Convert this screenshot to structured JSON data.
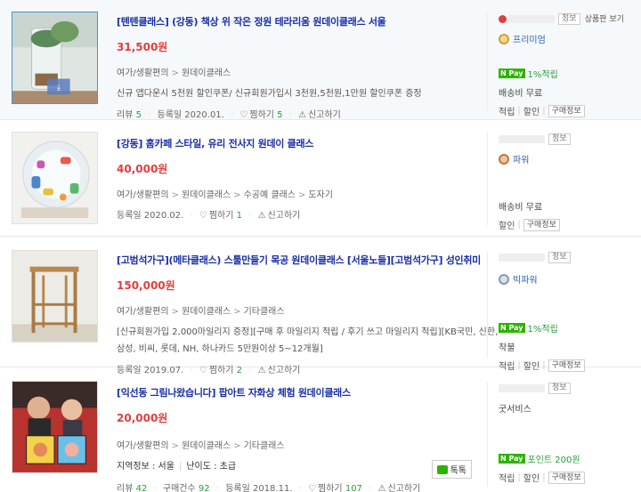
{
  "items": [
    {
      "title": "[텐텐클래스] (강동) 책상 위 작은 정원 테라리움 원데이클래스 서울",
      "price": "31,500원",
      "category": [
        "여가/생활편의",
        "원데이클래스"
      ],
      "desc": "신규 앱다운시 5천원 할인쿠폰/ 신규회원가입시 3천원,5천원,1만원 할인쿠폰 증정",
      "review_label": "리뷰",
      "review_count": "5",
      "reg_date": "등록일 2020.01.",
      "wish_label": "찜하기",
      "wish_count": "5",
      "report_label": "신고하기",
      "seller_info": "정보",
      "more_link": "상품판 보기",
      "grade": "프리미엄",
      "npay": "1%적립",
      "shipping": "배송비 무료",
      "btns": [
        "적립",
        "할인"
      ],
      "mini_btn": "구매정보"
    },
    {
      "title": "[강동] 홈카페 스타일, 유리 전사지 원데이 클래스",
      "price": "40,000원",
      "category": [
        "여가/생활편의",
        "원데이클래스",
        "수공예 클래스",
        "도자기"
      ],
      "reg_date": "등록일 2020.02.",
      "wish_label": "찜하기",
      "wish_count": "1",
      "report_label": "신고하기",
      "seller_info": "정보",
      "grade": "파워",
      "shipping": "배송비 무료",
      "btns": [
        "할인"
      ],
      "mini_btn": "구매정보"
    },
    {
      "title": "[고범석가구](메타클래스) 스툴만들기 목공 원데이클래스 [서울노들][고범석가구] 성인취미",
      "price": "150,000원",
      "category": [
        "여가/생활편의",
        "원데이클래스",
        "기타클래스"
      ],
      "desc1": "[신규회원가입 2,000마일리지 증정][구매 후 마일리지 적립 / 후기 쓰고 마일리지 적립][KB국민, 신한,",
      "desc2": "삼성, 비씨, 롯데, NH, 하나카드 5만원이상 5~12개월]",
      "reg_date": "등록일 2019.07.",
      "wish_label": "찜하기",
      "wish_count": "2",
      "report_label": "신고하기",
      "seller_info": "정보",
      "grade": "빅파워",
      "npay": "1%적립",
      "shipping": "착불",
      "btns": [
        "적립",
        "할인"
      ],
      "mini_btn": "구매정보"
    },
    {
      "title": "[익선동 그림나왔습니다] 팝아트 자화상 체험 원데이클래스",
      "price": "20,000원",
      "category": [
        "여가/생활편의",
        "원데이클래스",
        "기타클래스"
      ],
      "region_label": "지역정보 : 서울",
      "level_label": "난이도 : 초급",
      "review_label": "리뷰",
      "review_count": "42",
      "purchase_label": "구매건수",
      "purchase_count": "92",
      "reg_date": "등록일 2018.11.",
      "wish_label": "찜하기",
      "wish_count": "107",
      "report_label": "신고하기",
      "talk": "톡톡",
      "seller_info": "정보",
      "seller_name": "굿서비스",
      "npay": "포인트 200원",
      "btns": [
        "적립",
        "할인"
      ],
      "mini_btn": "구매정보"
    }
  ],
  "colors": {
    "title": "#1a2fa6",
    "price": "#e43d3d",
    "npay": "#2db400",
    "count": "#2a9d3a"
  }
}
